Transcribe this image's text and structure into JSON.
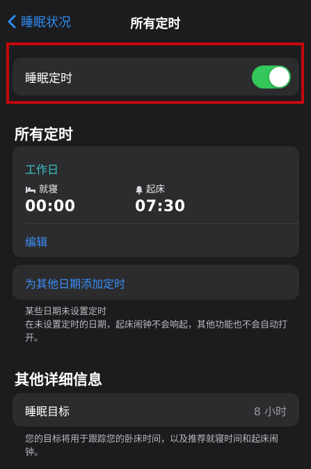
{
  "navbar": {
    "back_label": "睡眠状况",
    "title": "所有定时"
  },
  "sleep_schedule": {
    "label": "睡眠定时",
    "enabled": true
  },
  "schedules_section": {
    "title": "所有定时",
    "schedule": {
      "days": "工作日",
      "bedtime_label": "就寝",
      "bedtime_time": "00:00",
      "wake_label": "起床",
      "wake_time": "07:30",
      "edit_label": "编辑"
    },
    "add_label": "为其他日期添加定时",
    "note_title": "某些日期未设置定时",
    "note_body": "在未设置定时的日期，起床闹钟不会响起，其他功能也不会自动打开。"
  },
  "details_section": {
    "title": "其他详细信息",
    "sleep_goal_label": "睡眠目标",
    "sleep_goal_value": "8 小时",
    "note": "您的目标将用于跟踪您的卧床时间，以及推荐就寝时间和起床闹钟。"
  },
  "colors": {
    "background": "#1c1c1e",
    "card": "#2c2c2e",
    "accent_blue": "#3a8df6",
    "accent_teal": "#36c3c7",
    "toggle_on": "#34c759",
    "highlight_red": "#c4080c"
  },
  "icons": [
    "chevron-left-icon",
    "bed-icon",
    "bell-icon"
  ]
}
